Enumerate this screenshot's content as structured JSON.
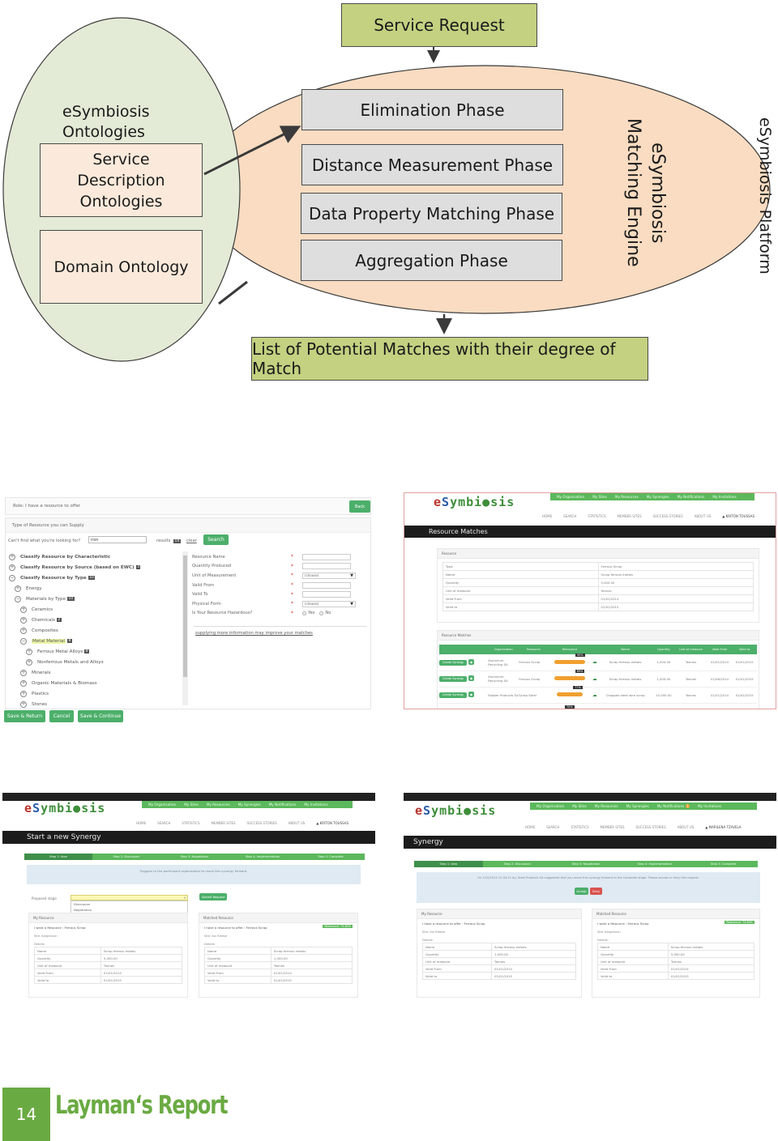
{
  "diagram": {
    "service_request": "Service Request",
    "ontologies_title": "eSymbiosis Ontologies",
    "ontologies_title_lines": [
      "eSymbiosis",
      "Ontologies"
    ],
    "service_description": "Service Description Ontologies",
    "domain_ontology": "Domain Ontology",
    "phases": [
      "Elimination Phase",
      "Distance Measurement Phase",
      "Data Property Matching Phase",
      "Aggregation Phase"
    ],
    "engine_label_lines": [
      "eSymbiosis",
      "Matching Engine"
    ],
    "platform_label": "eSymbiosis Platform",
    "output": "List of Potential Matches with their degree of Match",
    "colors": {
      "ontology_ellipse": "#e3ead6",
      "engine_ellipse": "#f9dcc1",
      "green_box": "#c3d181",
      "phase_box": "#dedede"
    }
  },
  "shot1": {
    "role": "Role: I have a resource to offer",
    "back": "Back",
    "type_heading": "Type of Resource you can Supply",
    "search_prompt": "Can't find what you're looking for?",
    "search_value": "iron",
    "results_label": "results",
    "results_count": "14",
    "clear": "clear",
    "search_button": "Search",
    "tree": [
      {
        "label": "Classify Resource by Characteristic",
        "icon": "plus",
        "level": 0,
        "badge": ""
      },
      {
        "label": "Classify Resource by Source (based on EWC)",
        "icon": "plus",
        "level": 0,
        "badge": "3"
      },
      {
        "label": "Classify Resource by Type",
        "icon": "minus",
        "level": 0,
        "badge": "10"
      },
      {
        "label": "Energy",
        "icon": "plus",
        "level": 1,
        "badge": ""
      },
      {
        "label": "Materials by Type",
        "icon": "minus",
        "level": 1,
        "badge": "10"
      },
      {
        "label": "Ceramics",
        "icon": "plus",
        "level": 2,
        "badge": ""
      },
      {
        "label": "Chemicals",
        "icon": "plus",
        "level": 2,
        "badge": "2"
      },
      {
        "label": "Composites",
        "icon": "plus",
        "level": 2,
        "badge": ""
      },
      {
        "label": "Metal Material",
        "icon": "minus",
        "level": 2,
        "badge": "8",
        "highlight": true
      },
      {
        "label": "Ferrous Metal Alloys",
        "icon": "plus",
        "level": 3,
        "badge": "8"
      },
      {
        "label": "Nonferrous Metals and Alloys",
        "icon": "plus",
        "level": 3,
        "badge": ""
      },
      {
        "label": "Minerals",
        "icon": "plus",
        "level": 2,
        "badge": ""
      },
      {
        "label": "Organic Materials & Biomass",
        "icon": "plus",
        "level": 2,
        "badge": ""
      },
      {
        "label": "Plastics",
        "icon": "plus",
        "level": 2,
        "badge": ""
      },
      {
        "label": "Stones",
        "icon": "plus",
        "level": 2,
        "badge": ""
      }
    ],
    "form": [
      {
        "label": "Resource Name",
        "type": "text",
        "value": ""
      },
      {
        "label": "Quantity Produced",
        "type": "text",
        "value": ""
      },
      {
        "label": "Unit of Measurement",
        "type": "select",
        "value": "(choose)"
      },
      {
        "label": "Valid From",
        "type": "text",
        "value": ""
      },
      {
        "label": "Valid To",
        "type": "text",
        "value": ""
      },
      {
        "label": "Physical Form",
        "type": "select",
        "value": "(choose)"
      },
      {
        "label": "Is Your Resource Hazardous?",
        "type": "radio",
        "options": [
          "Yes",
          "No"
        ]
      }
    ],
    "more_info_link": "supplying more information may improve your matches",
    "buttons": [
      "Save & Return",
      "Cancel",
      "Save & Continue"
    ]
  },
  "site": {
    "logo": "eSymbiosis",
    "top_nav": [
      "My Organisation",
      "My Sites",
      "My Resources",
      "My Synergies",
      "My Notifications",
      "My Invitations"
    ],
    "main_nav": [
      "HOME",
      "SEARCH",
      "STATISTICS",
      "MEMBER SITES",
      "SUCCESS STORIES",
      "ABOUT US"
    ],
    "user_a": "KRITON TOUSSAS",
    "user_b": "MARILENA TZAVELA",
    "notification_count": "1",
    "steps": [
      "Step 1: Idea",
      "Step 2: Discussion",
      "Step 3: Negotiation",
      "Step 4: Implementation",
      "Step 5: Complete"
    ]
  },
  "shot2": {
    "title": "Resource Matches",
    "resource_heading": "Resource",
    "resource": [
      [
        "Type",
        "Ferrous Scrap"
      ],
      [
        "Name",
        "Scrap ferrous metals"
      ],
      [
        "Quantity",
        "5,000.00"
      ],
      [
        "Unit of measure",
        "Tonnes"
      ],
      [
        "Valid From",
        "01/01/2014"
      ],
      [
        "Valid to",
        "01/01/2015"
      ]
    ],
    "matches_heading": "Resource Matches",
    "columns": [
      "",
      "Organization",
      "Resource",
      "Relevance",
      "",
      "Name",
      "Quantity",
      "Unit of measure",
      "Valid From",
      "Valid to"
    ],
    "create_label": "Create Synergy",
    "rows": [
      {
        "org": "Aluminum Recycling SA",
        "resource": "Ferrous Scrap",
        "relevance": 90,
        "relevance_label": "90%",
        "name": "Scrap ferrous metals",
        "quantity": "1,000.00",
        "unit": "Tonnes",
        "from": "01/01/2014",
        "to": "01/01/2015"
      },
      {
        "org": "Aluminum Recycling SA",
        "resource": "Ferrous Scrap",
        "relevance": 89,
        "relevance_label": "89%",
        "name": "Scrap ferrous metals",
        "quantity": "1,000.00",
        "unit": "Tonnes",
        "from": "01/06/2014",
        "to": "01/01/2015"
      },
      {
        "org": "Rubber Products SA",
        "resource": "Scrap Steel",
        "relevance": 77,
        "relevance_label": "77%",
        "name": "Chopped steel wire scrap",
        "quantity": "10,000.00",
        "unit": "Tonnes",
        "from": "01/01/2014",
        "to": "01/01/2015"
      }
    ],
    "partial_tip": "70%"
  },
  "shot3": {
    "title": "Start a new Synergy",
    "alert": "Suggest to the participant organisation to move this synergy forward.",
    "proposed_stage_label": "Proposed stage",
    "stage_options": [
      "Discussion",
      "Negotiation",
      "Implementation",
      "Complete"
    ],
    "selected_option": "Complete",
    "submit": "Submit Request",
    "my_resource": {
      "heading": "My Resource",
      "title": "I want a Resource : Ferrous Scrap",
      "site": "Site: Kargennon",
      "details_label": "Details:",
      "rows": [
        [
          "Name",
          "Scrap ferrous metals"
        ],
        [
          "Quantity",
          "5,000.00"
        ],
        [
          "Unit of measure",
          "Tonnes"
        ],
        [
          "Valid From",
          "01/01/2014"
        ],
        [
          "Valid to",
          "01/01/2015"
        ]
      ]
    },
    "matched_resource": {
      "heading": "Matched Resource",
      "title": "I have a resource to offer : Ferrous Scrap",
      "relevance": "Relevance: 73.80%",
      "site": "Site: Ani Ritiese",
      "details_label": "Details:",
      "rows": [
        [
          "Name",
          "Scrap ferrous metals"
        ],
        [
          "Quantity",
          "1,000.00"
        ],
        [
          "Unit of measure",
          "Tonnes"
        ],
        [
          "Valid From",
          "01/01/2014"
        ],
        [
          "Valid to",
          "01/01/2015"
        ]
      ]
    }
  },
  "shot4": {
    "title": "Synergy",
    "alert": "On 12/5/2014 11:34:21 πμ, Steel Products SA suggested that you move this synergy forward to the Complete stage. Please accept or deny this request.",
    "accept": "Accept",
    "deny": "Deny",
    "my_resource": {
      "heading": "My Resource",
      "title": "I have a resource to offer : Ferrous Scrap",
      "site": "Site: Ani Ritiese",
      "details_label": "Details:",
      "rows": [
        [
          "Name",
          "Scrap ferrous metals"
        ],
        [
          "Quantity",
          "1,000.00"
        ],
        [
          "Unit of measure",
          "Tonnes"
        ],
        [
          "Valid From",
          "01/01/2014"
        ],
        [
          "Valid to",
          "01/01/2015"
        ]
      ]
    },
    "matched_resource": {
      "heading": "Matched Resource",
      "title": "I want a Resource : Ferrous Scrap",
      "relevance": "Relevance: 73.80%",
      "site": "Site: Kargennon",
      "details_label": "Details:",
      "rows": [
        [
          "Name",
          "Scrap ferrous metals"
        ],
        [
          "Quantity",
          "5,000.00"
        ],
        [
          "Unit of measure",
          "Tonnes"
        ],
        [
          "Valid From",
          "01/01/2014"
        ],
        [
          "Valid to",
          "01/01/2015"
        ]
      ]
    }
  },
  "footer": {
    "page_number": "14",
    "title": "Layman‘s Report",
    "accent": "#6aaa42"
  }
}
